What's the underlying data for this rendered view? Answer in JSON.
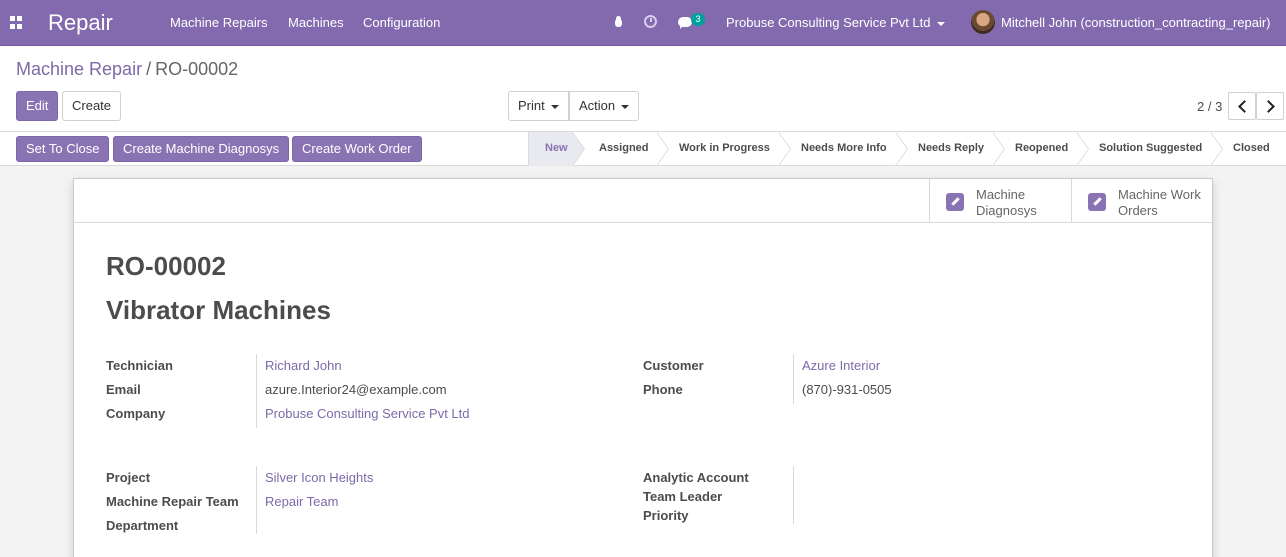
{
  "navbar": {
    "app_title": "Repair",
    "menu": [
      "Machine Repairs",
      "Machines",
      "Configuration"
    ],
    "messages_count": "3",
    "company": "Probuse Consulting Service Pvt Ltd",
    "user": "Mitchell John (construction_contracting_repair)",
    "color": "#8369ad"
  },
  "breadcrumb": {
    "parent": "Machine Repair",
    "separator": "/",
    "current": "RO-00002"
  },
  "toolbar": {
    "edit_label": "Edit",
    "create_label": "Create",
    "print_label": "Print",
    "action_label": "Action",
    "pager": "2 / 3"
  },
  "header_buttons": [
    "Set To Close",
    "Create Machine Diagnosys",
    "Create Work Order"
  ],
  "stages": {
    "items": [
      "New",
      "Assigned",
      "Work in Progress",
      "Needs More Info",
      "Needs Reply",
      "Reopened",
      "Solution Suggested",
      "Closed"
    ],
    "active": "New"
  },
  "smart_buttons": {
    "diagnosys": [
      "Machine",
      "Diagnosys"
    ],
    "work_orders": [
      "Machine Work",
      "Orders"
    ]
  },
  "record": {
    "reference": "RO-00002",
    "name": "Vibrator Machines"
  },
  "fields": {
    "technician_label": "Technician",
    "technician": "Richard John",
    "email_label": "Email",
    "email": "azure.Interior24@example.com",
    "company_label": "Company",
    "company": "Probuse Consulting Service Pvt Ltd",
    "customer_label": "Customer",
    "customer": "Azure Interior",
    "phone_label": "Phone",
    "phone": "(870)-931-0505",
    "project_label": "Project",
    "project": "Silver Icon Heights",
    "team_label": "Machine Repair Team",
    "team": "Repair Team",
    "department_label": "Department",
    "analytic_label": "Analytic Account",
    "team_leader_label": "Team Leader",
    "priority_label": "Priority"
  }
}
